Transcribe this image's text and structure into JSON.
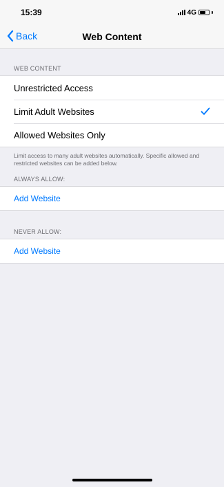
{
  "status_bar": {
    "time": "15:39",
    "network": "4G",
    "icons": [
      "signal-icon",
      "battery-icon"
    ]
  },
  "nav": {
    "back_label": "Back",
    "title": "Web Content"
  },
  "web_content_section": {
    "header": "WEB CONTENT",
    "options": [
      {
        "label": "Unrestricted Access",
        "selected": false
      },
      {
        "label": "Limit Adult Websites",
        "selected": true
      },
      {
        "label": "Allowed Websites Only",
        "selected": false
      }
    ],
    "footer": "Limit access to many adult websites automatically. Specific allowed and restricted websites can be added below."
  },
  "always_allow_section": {
    "header": "ALWAYS ALLOW:",
    "add_label": "Add Website"
  },
  "never_allow_section": {
    "header": "NEVER ALLOW:",
    "add_label": "Add Website"
  },
  "colors": {
    "accent": "#007aff",
    "background": "#efeff4"
  }
}
